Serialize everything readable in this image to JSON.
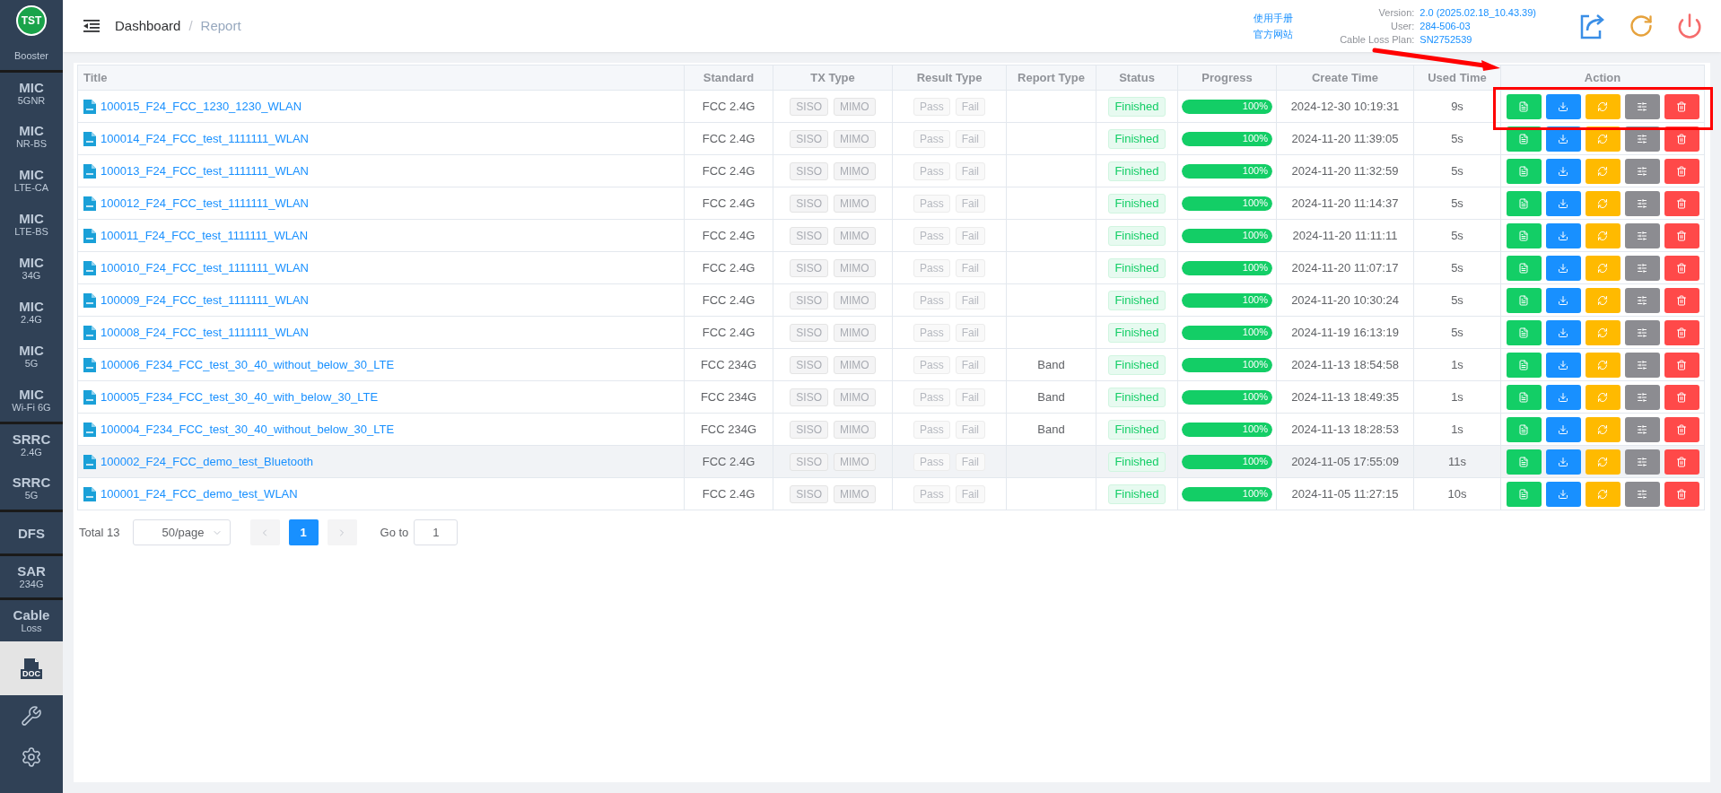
{
  "logo": "TST",
  "sidebar": {
    "items": [
      {
        "kind": "text",
        "subtitle": "Booster",
        "selected": false,
        "divider_before": false
      },
      {
        "kind": "text",
        "title": "MIC",
        "subtitle": "5GNR",
        "selected": false,
        "divider_before": true
      },
      {
        "kind": "text",
        "title": "MIC",
        "subtitle": "NR-BS",
        "selected": false,
        "divider_before": false
      },
      {
        "kind": "text",
        "title": "MIC",
        "subtitle": "LTE-CA",
        "selected": false,
        "divider_before": false
      },
      {
        "kind": "text",
        "title": "MIC",
        "subtitle": "LTE-BS",
        "selected": false,
        "divider_before": false
      },
      {
        "kind": "text",
        "title": "MIC",
        "subtitle": "34G",
        "selected": false,
        "divider_before": false
      },
      {
        "kind": "text",
        "title": "MIC",
        "subtitle": "2.4G",
        "selected": false,
        "divider_before": false
      },
      {
        "kind": "text",
        "title": "MIC",
        "subtitle": "5G",
        "selected": false,
        "divider_before": false
      },
      {
        "kind": "text",
        "title": "MIC",
        "subtitle": "Wi-Fi 6G",
        "selected": false,
        "divider_before": false
      },
      {
        "kind": "text",
        "title": "SRRC",
        "subtitle": "2.4G",
        "selected": false,
        "divider_before": true
      },
      {
        "kind": "text",
        "title": "SRRC",
        "subtitle": "5G",
        "selected": false,
        "divider_before": false
      },
      {
        "kind": "text",
        "title": "DFS",
        "selected": false,
        "divider_before": true
      },
      {
        "kind": "text",
        "title": "SAR",
        "subtitle": "234G",
        "selected": false,
        "divider_before": true
      },
      {
        "kind": "text",
        "title": "Cable",
        "subtitle": "Loss",
        "selected": false,
        "divider_before": true
      },
      {
        "kind": "doc",
        "title": "DOC",
        "selected": true,
        "divider_before": false
      },
      {
        "kind": "wrench",
        "selected": false,
        "divider_before": false
      },
      {
        "kind": "gear",
        "selected": false,
        "divider_before": false
      }
    ]
  },
  "header": {
    "breadcrumb": [
      "Dashboard",
      "Report"
    ],
    "separator": "/",
    "links": [
      "使用手册",
      "官方网站"
    ],
    "info": [
      {
        "label": "Version:",
        "value": "2.0 (2025.02.18_10.43.39)"
      },
      {
        "label": "User:",
        "value": "284-506-03"
      },
      {
        "label": "Cable Loss Plan:",
        "value": "SN2752539"
      }
    ],
    "buttons": [
      {
        "kind": "export",
        "color": "#3a8ee6"
      },
      {
        "kind": "refresh",
        "color": "#e6a23c"
      },
      {
        "kind": "power",
        "color": "#f56c6c"
      }
    ]
  },
  "table": {
    "columns": [
      "Title",
      "Standard",
      "TX Type",
      "Result Type",
      "Report Type",
      "Status",
      "Progress",
      "Create Time",
      "Used Time",
      "Action"
    ],
    "row_actions": [
      {
        "kind": "view",
        "color": "#13ce66"
      },
      {
        "kind": "download",
        "color": "#1890ff"
      },
      {
        "kind": "refresh",
        "color": "#ffba00"
      },
      {
        "kind": "settings",
        "color": "#8c8c91"
      },
      {
        "kind": "delete",
        "color": "#ff4949"
      }
    ],
    "rows": [
      {
        "title": "100015_F24_FCC_1230_1230_WLAN",
        "standard": "FCC 2.4G",
        "tx": [
          "SISO",
          "MIMO"
        ],
        "result": [
          "Pass",
          "Fail"
        ],
        "report_type": "",
        "status": "Finished",
        "level": 1,
        "progress": "100%",
        "create_time": "2024-12-30 10:19:31",
        "used_time": "9s",
        "selected": false
      },
      {
        "title": "100014_F24_FCC_test_1111111_WLAN",
        "standard": "FCC 2.4G",
        "tx": [
          "SISO",
          "MIMO"
        ],
        "result": [
          "Pass",
          "Fail"
        ],
        "report_type": "",
        "status": "Finished",
        "level": 1,
        "progress": "100%",
        "create_time": "2024-11-20 11:39:05",
        "used_time": "5s",
        "selected": false
      },
      {
        "title": "100013_F24_FCC_test_1111111_WLAN",
        "standard": "FCC 2.4G",
        "tx": [
          "SISO",
          "MIMO"
        ],
        "result": [
          "Pass",
          "Fail"
        ],
        "report_type": "",
        "status": "Finished",
        "level": 1,
        "progress": "100%",
        "create_time": "2024-11-20 11:32:59",
        "used_time": "5s",
        "selected": false
      },
      {
        "title": "100012_F24_FCC_test_1111111_WLAN",
        "standard": "FCC 2.4G",
        "tx": [
          "SISO",
          "MIMO"
        ],
        "result": [
          "Pass",
          "Fail"
        ],
        "report_type": "",
        "status": "Finished",
        "level": 1,
        "progress": "100%",
        "create_time": "2024-11-20 11:14:37",
        "used_time": "5s",
        "selected": false
      },
      {
        "title": "100011_F24_FCC_test_1111111_WLAN",
        "standard": "FCC 2.4G",
        "tx": [
          "SISO",
          "MIMO"
        ],
        "result": [
          "Pass",
          "Fail"
        ],
        "report_type": "",
        "status": "Finished",
        "level": 1,
        "progress": "100%",
        "create_time": "2024-11-20 11:11:11",
        "used_time": "5s",
        "selected": false
      },
      {
        "title": "100010_F24_FCC_test_1111111_WLAN",
        "standard": "FCC 2.4G",
        "tx": [
          "SISO",
          "MIMO"
        ],
        "result": [
          "Pass",
          "Fail"
        ],
        "report_type": "",
        "status": "Finished",
        "level": 1,
        "progress": "100%",
        "create_time": "2024-11-20 11:07:17",
        "used_time": "5s",
        "selected": false
      },
      {
        "title": "100009_F24_FCC_test_1111111_WLAN",
        "standard": "FCC 2.4G",
        "tx": [
          "SISO",
          "MIMO"
        ],
        "result": [
          "Pass",
          "Fail"
        ],
        "report_type": "",
        "status": "Finished",
        "level": 1,
        "progress": "100%",
        "create_time": "2024-11-20 10:30:24",
        "used_time": "5s",
        "selected": false
      },
      {
        "title": "100008_F24_FCC_test_1111111_WLAN",
        "standard": "FCC 2.4G",
        "tx": [
          "SISO",
          "MIMO"
        ],
        "result": [
          "Pass",
          "Fail"
        ],
        "report_type": "",
        "status": "Finished",
        "level": 1,
        "progress": "100%",
        "create_time": "2024-11-19 16:13:19",
        "used_time": "5s",
        "selected": false
      },
      {
        "title": "100006_F234_FCC_test_30_40_without_below_30_LTE",
        "standard": "FCC 234G",
        "tx": [
          "SISO",
          "MIMO"
        ],
        "result": [
          "Pass",
          "Fail"
        ],
        "report_type": "Band",
        "status": "Finished",
        "level": 1,
        "progress": "100%",
        "create_time": "2024-11-13 18:54:58",
        "used_time": "1s",
        "selected": false
      },
      {
        "title": "100005_F234_FCC_test_30_40_with_below_30_LTE",
        "standard": "FCC 234G",
        "tx": [
          "SISO",
          "MIMO"
        ],
        "result": [
          "Pass",
          "Fail"
        ],
        "report_type": "Band",
        "status": "Finished",
        "level": 1,
        "progress": "100%",
        "create_time": "2024-11-13 18:49:35",
        "used_time": "1s",
        "selected": false
      },
      {
        "title": "100004_F234_FCC_test_30_40_without_below_30_LTE",
        "standard": "FCC 234G",
        "tx": [
          "SISO",
          "MIMO"
        ],
        "result": [
          "Pass",
          "Fail"
        ],
        "report_type": "Band",
        "status": "Finished",
        "level": 1,
        "progress": "100%",
        "create_time": "2024-11-13 18:28:53",
        "used_time": "1s",
        "selected": false
      },
      {
        "title": "100002_F24_FCC_demo_test_Bluetooth",
        "standard": "FCC 2.4G",
        "tx": [
          "SISO",
          "MIMO"
        ],
        "result": [
          "Pass",
          "Fail"
        ],
        "report_type": "",
        "status": "Finished",
        "level": 1,
        "progress": "100%",
        "create_time": "2024-11-05 17:55:09",
        "used_time": "11s",
        "selected": true
      },
      {
        "title": "100001_F24_FCC_demo_test_WLAN",
        "standard": "FCC 2.4G",
        "tx": [
          "SISO",
          "MIMO"
        ],
        "result": [
          "Pass",
          "Fail"
        ],
        "report_type": "",
        "status": "Finished",
        "level": 1,
        "progress": "100%",
        "create_time": "2024-11-05 11:27:15",
        "used_time": "10s",
        "selected": false
      }
    ]
  },
  "pagination": {
    "total": "Total 13",
    "page_size": "50/page",
    "pages": [
      {
        "label": "1",
        "selected": true
      }
    ],
    "goto_label": "Go to",
    "goto_value": "1"
  },
  "annotation": {
    "kind": "arrow-box",
    "color": "#ff0000"
  }
}
